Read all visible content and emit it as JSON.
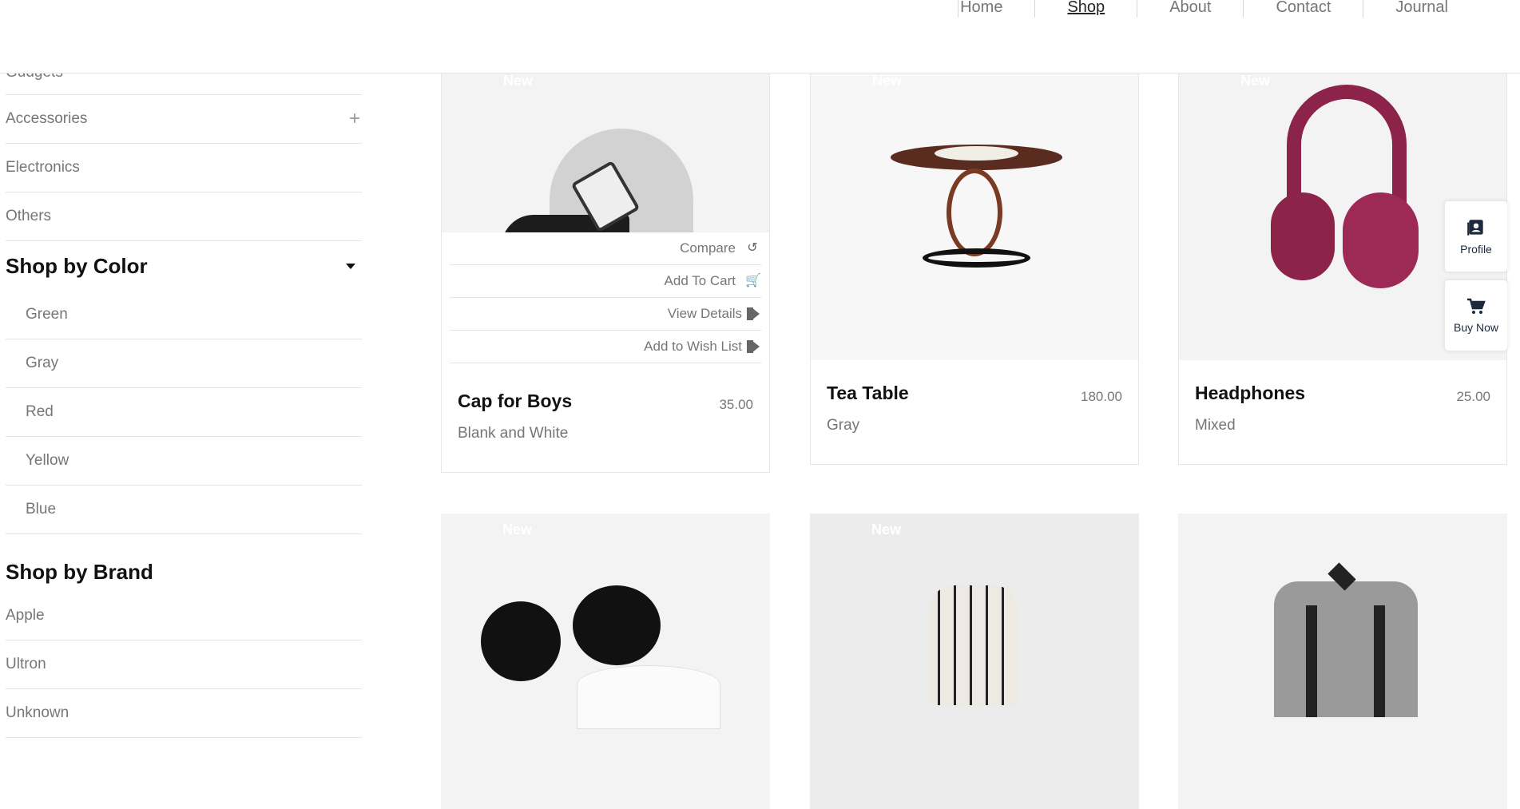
{
  "nav": {
    "items": [
      {
        "label": "Home"
      },
      {
        "label": "Shop"
      },
      {
        "label": "About"
      },
      {
        "label": "Contact"
      },
      {
        "label": "Journal"
      }
    ]
  },
  "sidebar": {
    "categories": [
      {
        "label": "Gudgets"
      },
      {
        "label": "Accessories",
        "expand": "+"
      },
      {
        "label": "Electronics"
      },
      {
        "label": "Others"
      }
    ],
    "color_heading": "Shop by Color",
    "colors": [
      "Green",
      "Gray",
      "Red",
      "Yellow",
      "Blue"
    ],
    "brand_heading": "Shop by Brand",
    "brands": [
      "Apple",
      "Ultron",
      "Unknown"
    ]
  },
  "badge_label": "New",
  "actions": {
    "compare": "Compare",
    "add_to_cart": "Add To Cart",
    "view_details": "View Details",
    "add_to_wishlist": "Add to Wish List"
  },
  "products": [
    {
      "name": "Cap for Boys",
      "price": "35.00",
      "color": "Blank and White",
      "badge": "New"
    },
    {
      "name": "Tea Table",
      "price": "180.00",
      "color": "Gray",
      "badge": "New"
    },
    {
      "name": "Headphones",
      "price": "25.00",
      "color": "Mixed",
      "badge": "New"
    },
    {
      "badge": "New"
    },
    {
      "badge": "New"
    },
    {}
  ],
  "floating": {
    "profile": "Profile",
    "buy_now": "Buy Now"
  }
}
